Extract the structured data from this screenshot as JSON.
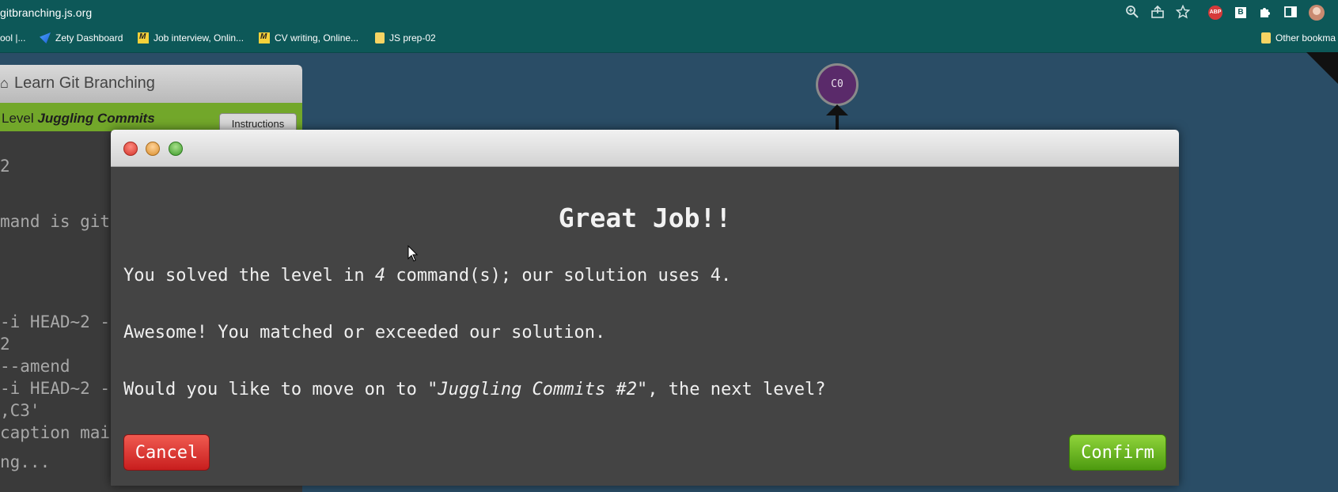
{
  "browser": {
    "url": "gitbranching.js.org",
    "toolbar_icons": [
      "zoom-icon",
      "share-icon",
      "star-icon",
      "abp-icon",
      "b-extension-icon",
      "extensions-puzzle-icon",
      "side-panel-icon",
      "profile-avatar"
    ],
    "abp_label": "ABP",
    "b_label": "B"
  },
  "bookmarks": {
    "items": [
      {
        "label": "ool |...",
        "icon": "partial"
      },
      {
        "label": "Zety Dashboard",
        "icon": "zety-icon"
      },
      {
        "label": "Job interview, Onlin...",
        "icon": "miro-icon"
      },
      {
        "label": "CV writing, Online...",
        "icon": "miro-icon"
      },
      {
        "label": "JS prep-02",
        "icon": "folder-icon"
      }
    ],
    "other": "Other bookma"
  },
  "app": {
    "title": "Learn Git Branching",
    "level_prefix": "Level ",
    "level_name": "Juggling Commits",
    "instructions_label": "Instructions",
    "terminal_lines": [
      "2",
      "",
      "mand is git",
      "",
      "",
      "-i HEAD~2 -",
      "2",
      "--amend",
      "-i HEAD~2 -",
      ",C3'",
      "caption mai",
      "",
      "ng..."
    ],
    "commit_node": "C0",
    "colors": {
      "background": "#2a4d66",
      "level_bar": "#72a72a",
      "commit_node": "#5a2a6a"
    }
  },
  "modal": {
    "heading": "Great Job!!",
    "line1_a": "You solved the level in ",
    "line1_num": "4",
    "line1_b": " command(s); our solution uses 4.",
    "line2": "Awesome! You matched or exceeded our solution.",
    "line3_a": "Would you like to move on to ",
    "line3_level": "\"Juggling Commits #2\"",
    "line3_b": ", the next level?",
    "cancel_label": "Cancel",
    "confirm_label": "Confirm",
    "colors": {
      "cancel": "#d9342a",
      "confirm": "#6cb21f",
      "body": "#444444"
    }
  }
}
